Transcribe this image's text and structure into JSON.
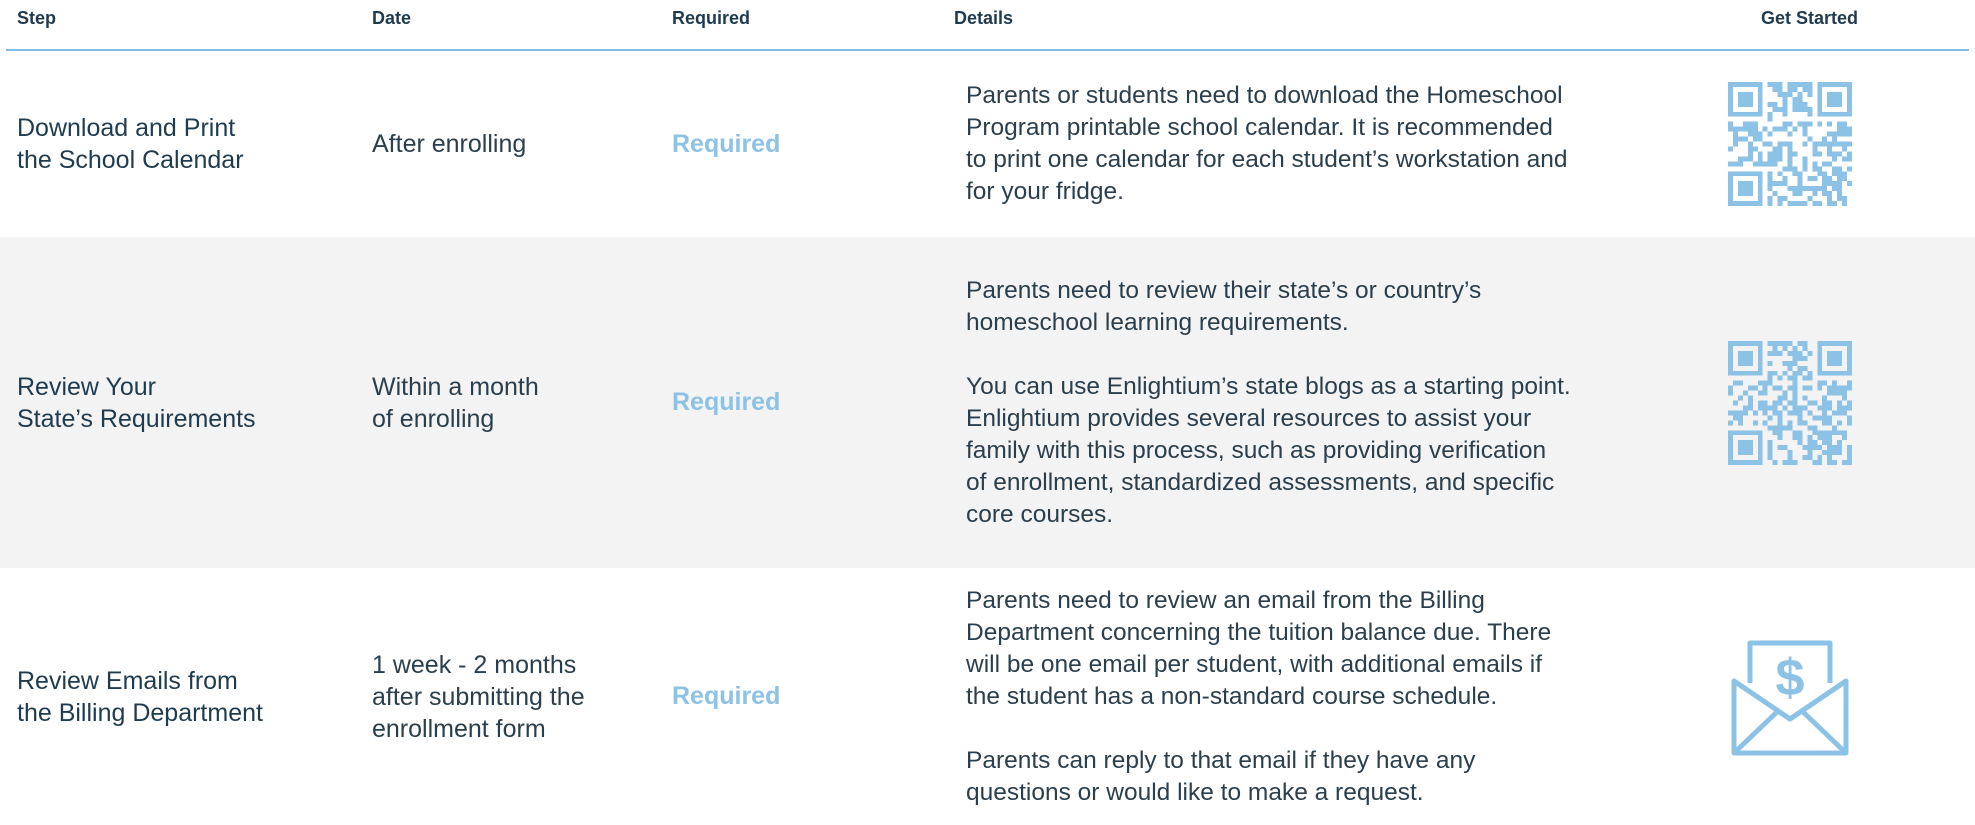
{
  "columns": {
    "step": "Step",
    "date": "Date",
    "required": "Required",
    "details": "Details",
    "get_started": "Get Started"
  },
  "rows": [
    {
      "step": "Download and Print\nthe School Calendar",
      "date": "After enrolling",
      "required": "Required",
      "details": [
        "Parents or students need to download the Homeschool\nProgram printable school calendar. It is recommended\nto print one calendar for each student’s workstation and\nfor your fridge."
      ],
      "icon": "qr-code-icon"
    },
    {
      "step": "Review Your\nState’s Requirements",
      "date": "Within a month\nof enrolling",
      "required": "Required",
      "details": [
        "Parents need to review their state’s or country’s\nhomeschool learning requirements.",
        "You can use Enlightium’s state blogs as a starting point.\nEnlightium provides several resources to assist your\nfamily with this process, such as providing verification\nof enrollment, standardized assessments, and specific\ncore courses."
      ],
      "icon": "qr-code-icon"
    },
    {
      "step": "Review Emails from\nthe Billing Department",
      "date": "1 week - 2 months\nafter submitting the\nenrollment form",
      "required": "Required",
      "details": [
        "Parents need to review an email from the Billing\nDepartment concerning the tuition balance due. There\nwill be one email per student, with additional emails if\nthe student has a non-standard course schedule.",
        "Parents can reply to that email if they have any\nquestions or would like to make a request."
      ],
      "icon": "envelope-dollar-icon"
    }
  ],
  "colors": {
    "header_text": "#1f3b4f",
    "accent": "#8cc2e6",
    "rule": "#84bde2",
    "stripe": "#f3f3f3"
  }
}
